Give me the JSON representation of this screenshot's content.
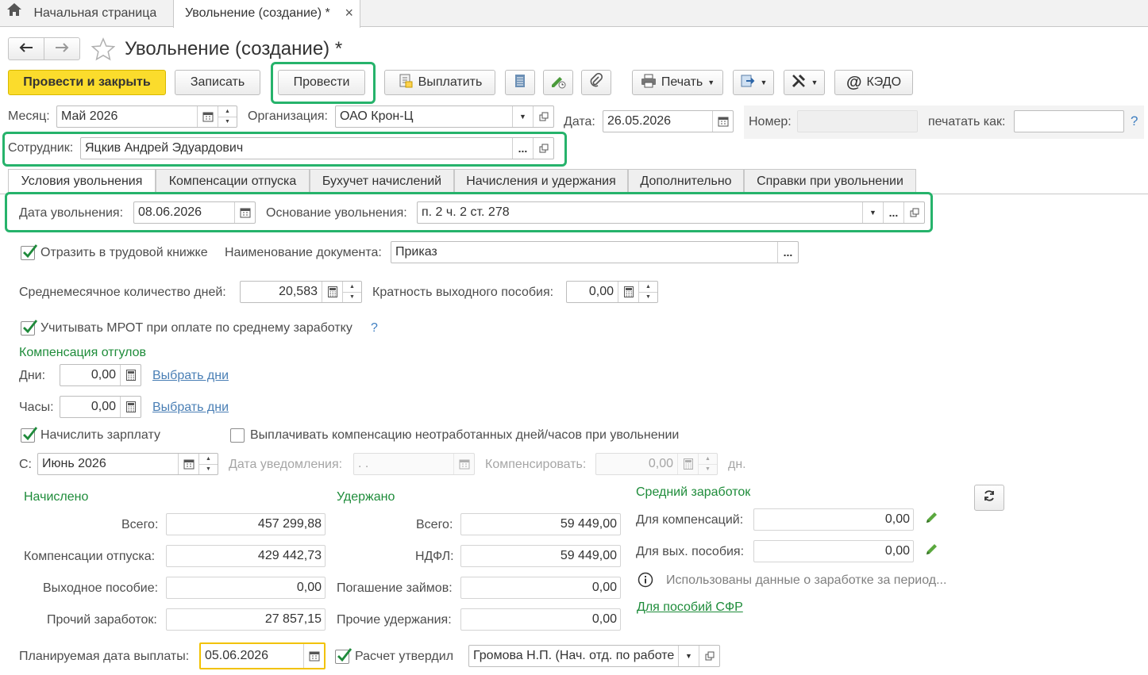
{
  "tabs": {
    "home": "Начальная страница",
    "doc": "Увольнение (создание) *",
    "close": "×"
  },
  "header": {
    "title": "Увольнение (создание) *"
  },
  "toolbar": {
    "post_close": "Провести и закрыть",
    "save": "Записать",
    "post": "Провести",
    "pay": "Выплатить",
    "print": "Печать",
    "kedo": "КЭДО"
  },
  "fields": {
    "month_label": "Месяц:",
    "month_value": "Май 2026",
    "org_label": "Организация:",
    "org_value": "ОАО Крон-Ц",
    "date_label": "Дата:",
    "date_value": "26.05.2026",
    "number_label": "Номер:",
    "number_value": "",
    "print_as_label": "печатать как:",
    "print_as_value": "",
    "help": "?",
    "employee_label": "Сотрудник:",
    "employee_value": "Яцкив Андрей Эдуардович"
  },
  "section_tabs": [
    "Условия увольнения",
    "Компенсации отпуска",
    "Бухучет начислений",
    "Начисления и удержания",
    "Дополнительно",
    "Справки при увольнении"
  ],
  "conditions": {
    "dismissal_date_label": "Дата увольнения:",
    "dismissal_date_value": "08.06.2026",
    "basis_label": "Основание увольнения:",
    "basis_value": "п. 2 ч. 2 ст. 278",
    "labor_book_checked": true,
    "labor_book_label": "Отразить в трудовой книжке",
    "doc_name_label": "Наименование документа:",
    "doc_name_value": "Приказ",
    "avg_days_label": "Среднемесячное количество дней:",
    "avg_days_value": "20,583",
    "severance_mult_label": "Кратность выходного пособия:",
    "severance_mult_value": "0,00",
    "mrot_checked": true,
    "mrot_label": "Учитывать МРОТ при оплате по среднему заработку",
    "mrot_help": "?",
    "timeoff_title": "Компенсация отгулов",
    "days_label": "Дни:",
    "days_value": "0,00",
    "hours_label": "Часы:",
    "hours_value": "0,00",
    "choose_days": "Выбрать дни",
    "calc_salary_checked": true,
    "calc_salary_label": "Начислить зарплату",
    "pay_unworked_checked": false,
    "pay_unworked_label": "Выплачивать компенсацию неотработанных дней/часов при увольнении",
    "from_label": "С:",
    "from_value": "Июнь 2026",
    "notice_date_label": "Дата уведомления:",
    "notice_date_value": " .  .",
    "compensate_label": "Компенсировать:",
    "compensate_value": "0,00",
    "days_unit": "дн."
  },
  "accrued": {
    "title": "Начислено",
    "total_label": "Всего:",
    "total": "457 299,88",
    "vacation_comp_label": "Компенсации отпуска:",
    "vacation_comp": "429 442,73",
    "severance_label": "Выходное пособие:",
    "severance": "0,00",
    "other_label": "Прочий заработок:",
    "other": "27 857,15"
  },
  "withheld": {
    "title": "Удержано",
    "total_label": "Всего:",
    "total": "59 449,00",
    "ndfl_label": "НДФЛ:",
    "ndfl": "59 449,00",
    "loans_label": "Погашение займов:",
    "loans": "0,00",
    "other_label": "Прочие удержания:",
    "other": "0,00"
  },
  "avg_earnings": {
    "title": "Средний заработок",
    "comp_label": "Для компенсаций:",
    "comp_value": "0,00",
    "sev_label": "Для вых. пособия:",
    "sev_value": "0,00",
    "info": "Использованы данные о заработке за период...",
    "sfr_link": "Для пособий СФР"
  },
  "footer": {
    "plan_date_label": "Планируемая дата выплаты:",
    "plan_date_value": "05.06.2026",
    "approved_checked": true,
    "approved_label": "Расчет утвердил",
    "approved_value": "Громова Н.П. (Нач. отд. по работе"
  },
  "colors": {
    "primary_button": "#fbdc2c",
    "highlight": "#26b36b",
    "section_title": "#1e8c3a",
    "link": "#4a7fb5",
    "active_input_border": "#f2c200"
  }
}
